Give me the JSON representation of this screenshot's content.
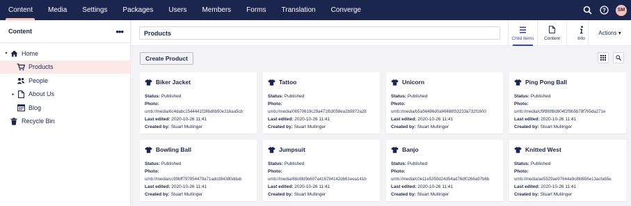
{
  "topnav": {
    "items": [
      "Content",
      "Media",
      "Settings",
      "Packages",
      "Users",
      "Members",
      "Forms",
      "Translation",
      "Converge"
    ],
    "active": "Content",
    "user_initials": "SM"
  },
  "sidebar": {
    "title": "Content",
    "menu_icon": "ellipsis-icon",
    "tree": [
      {
        "label": "Home",
        "icon": "home-icon",
        "caret": "▾"
      },
      {
        "label": "Products",
        "icon": "shopping-cart-icon",
        "caret": ""
      },
      {
        "label": "People",
        "icon": "people-icon",
        "caret": ""
      },
      {
        "label": "About Us",
        "icon": "document-icon",
        "caret": "▸"
      },
      {
        "label": "Blog",
        "icon": "calendar-icon",
        "caret": ""
      },
      {
        "label": "Recycle Bin",
        "icon": "trash-icon",
        "caret": ""
      }
    ]
  },
  "editor": {
    "node_name": "Products",
    "apps": [
      {
        "label": "Child items",
        "icon": "list-icon"
      },
      {
        "label": "Content",
        "icon": "document-icon"
      },
      {
        "label": "Info",
        "icon": "info-icon"
      }
    ],
    "actions_label": "Actions ▾",
    "create_label": "Create Product"
  },
  "cards": {
    "status_label": "Status:",
    "photo_label": "Photo:",
    "edited_label": "Last edited:",
    "created_label": "Created by:",
    "items": [
      {
        "title": "Biker Jacket",
        "status": "Published",
        "photo": "umb://media/6c4dabc1544441f286d8b50e316aa5cb",
        "edited": "2020-10-26 11:41",
        "creator": "Stuart Mullinger"
      },
      {
        "title": "Tattoo",
        "status": "Published",
        "photo": "umb://media/06570619c29a471fb3058ea2b5872a28",
        "edited": "2020-10-26 11:41",
        "creator": "Stuart Mullinger"
      },
      {
        "title": "Unicorn",
        "status": "Published",
        "photo": "umb://media/b5a56486d0af4f488f33233a732f1600",
        "edited": "2020-10-26 11:41",
        "creator": "Stuart Mullinger"
      },
      {
        "title": "Ping Pong Ball",
        "status": "Published",
        "photo": "umb://media/cf9f8fdf8d904f2f9b5b78f765da271e",
        "edited": "2020-10-26 11:41",
        "creator": "Stuart Mullinger"
      },
      {
        "title": "Bowling Ball",
        "status": "Published",
        "photo": "umb://media/cc99bff797854479a71adcd84380ddab",
        "edited": "2020-10-26 11:41",
        "creator": "Stuart Mullinger"
      },
      {
        "title": "Jumpsuit",
        "status": "Published",
        "photo": "umb://media/88c6fd5b607a416784142db61eea141b",
        "edited": "2020-10-26 11:41",
        "creator": "Stuart Mullinger"
      },
      {
        "title": "Banjo",
        "status": "Published",
        "photo": "umb://media/c0e11e5350d24d54ad76df0266a97b6b",
        "edited": "2020-10-26 11:41",
        "creator": "Stuart Mullinger"
      },
      {
        "title": "Knitted West",
        "status": "Published",
        "photo": "umb://media/ae5529ae97644a9c8fd656e13acfa65e",
        "edited": "2020-10-26 11:41",
        "creator": "Stuart Mullinger"
      }
    ]
  },
  "colors": {
    "nav_bg": "#1b264f",
    "accent_pink": "#f5c1bc",
    "selected_bg": "#fce8e6",
    "active_app": "#3544b1"
  }
}
